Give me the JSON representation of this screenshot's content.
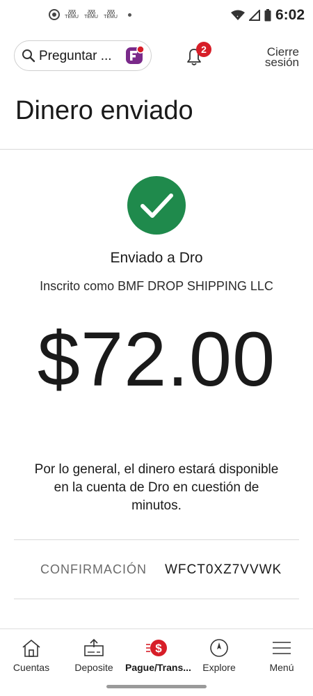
{
  "status_bar": {
    "time": "6:02",
    "notification_icons": [
      "whatsapp-icon",
      "temu-icon",
      "temu-icon",
      "temu-icon"
    ],
    "temu_label": "TEMU",
    "temu_glyph": "ᵹᵹᵹ",
    "system_icons": [
      "wifi-icon",
      "signal-icon",
      "battery-icon"
    ]
  },
  "top_bar": {
    "search_placeholder": "Preguntar ...",
    "notification_count": "2",
    "logout_label_line1": "Cierre",
    "logout_label_line2": "sesión"
  },
  "page": {
    "title": "Dinero enviado",
    "sent_to": "Enviado a Dro",
    "enrolled_as": "Inscrito como BMF DROP SHIPPING LLC",
    "amount": "$72.00",
    "info_line1": "Por lo general, el dinero estará disponible",
    "info_line2": "en la cuenta de Dro en cuestión de",
    "info_line3": "minutos.",
    "confirmation_label": "CONFIRMACIÓN",
    "confirmation_value": "WFCT0XZ7VVWK"
  },
  "bottom_nav": {
    "items": [
      {
        "label": "Cuentas",
        "icon": "home-icon"
      },
      {
        "label": "Deposite",
        "icon": "deposit-icon"
      },
      {
        "label": "Pague/Trans...",
        "icon": "pay-transfer-icon",
        "active": true
      },
      {
        "label": "Explore",
        "icon": "compass-icon"
      },
      {
        "label": "Menú",
        "icon": "menu-icon"
      }
    ]
  },
  "colors": {
    "brand_red": "#d71e28",
    "success_green": "#1f8a4c",
    "text": "#1a1a1a",
    "muted": "#6b6b6b"
  }
}
